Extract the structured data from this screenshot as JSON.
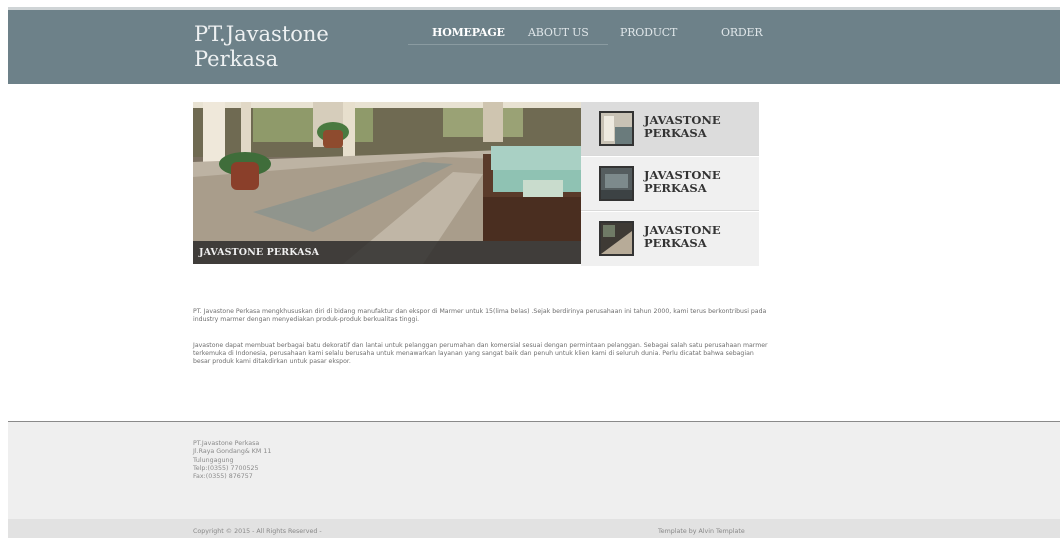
{
  "brand": {
    "name": "PT.Javastone Perkasa"
  },
  "nav": {
    "items": [
      {
        "label": "HOMEPAGE",
        "active": true
      },
      {
        "label": "ABOUT US",
        "active": false
      },
      {
        "label": "PRODUCT",
        "active": false
      },
      {
        "label": "ORDER",
        "active": false
      }
    ]
  },
  "slider": {
    "caption": "JAVASTONE PERKASA",
    "thumbs": [
      {
        "label": "JAVASTONE PERKASA",
        "active": true
      },
      {
        "label": "JAVASTONE PERKASA",
        "active": false
      },
      {
        "label": "JAVASTONE PERKASA",
        "active": false
      }
    ]
  },
  "content": {
    "paragraphs": [
      "PT. Javastone Perkasa mengkhususkan diri di bidang manufaktur dan ekspor di Marmer untuk 15(lima belas) .Sejak berdirinya perusahaan ini tahun 2000, kami terus berkontribusi pada industry marmer dengan menyediakan produk-produk berkualitas tinggi.",
      "Javastone dapat membuat berbagai batu dekoratif dan lantai untuk pelanggan perumahan dan komersial sesuai dengan permintaan pelanggan. Sebagai salah satu perusahaan marmer terkemuka di Indonesia, perusahaan kami selalu berusaha untuk menawarkan layanan yang sangat baik dan penuh untuk klien kami di seluruh dunia. Perlu dicatat bahwa sebagian besar produk kami ditakdirkan untuk pasar ekspor."
    ]
  },
  "footer": {
    "address": {
      "company": "PT.Javastone Perkasa",
      "street": "Jl.Raya Gondang& KM 11",
      "city": "Tulungagung",
      "phone": "Telp:(0355) 7700525",
      "fax": "Fax:(0355) 876757"
    },
    "copyright": "Copyright © 2015 - All Rights Reserved -",
    "template_credit": "Template by Alvin Template"
  }
}
